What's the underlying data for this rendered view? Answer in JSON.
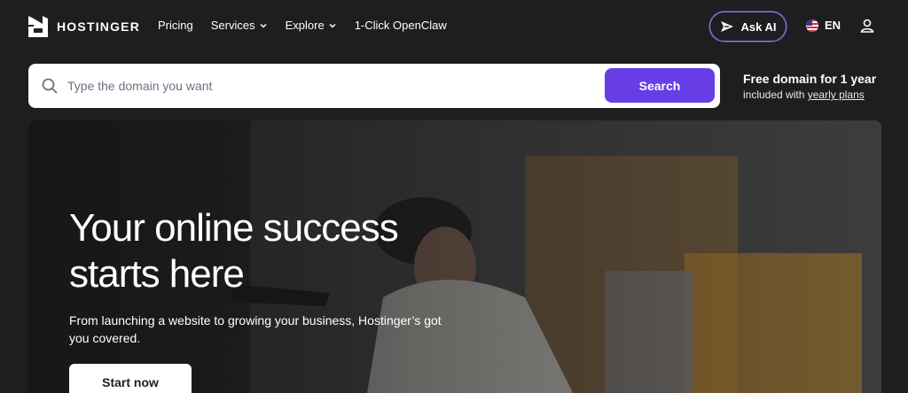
{
  "brand": {
    "name": "HOSTINGER"
  },
  "nav": {
    "items": [
      {
        "label": "Pricing",
        "dropdown": false
      },
      {
        "label": "Services",
        "dropdown": true
      },
      {
        "label": "Explore",
        "dropdown": true
      },
      {
        "label": "1-Click OpenClaw",
        "dropdown": false
      }
    ],
    "ask_ai": "Ask AI",
    "language": "EN"
  },
  "search": {
    "placeholder": "Type the domain you want",
    "button_label": "Search"
  },
  "promo": {
    "title": "Free domain for 1 year",
    "sub_prefix": "included with ",
    "link": "yearly plans"
  },
  "hero": {
    "title": "Your online success starts here",
    "subtitle": "From launching a website to growing your business, Hostinger’s got you covered.",
    "cta": "Start now"
  },
  "colors": {
    "background": "#1d1e20",
    "accent": "#673de6",
    "ask_ai_border": "#8c85ff"
  }
}
